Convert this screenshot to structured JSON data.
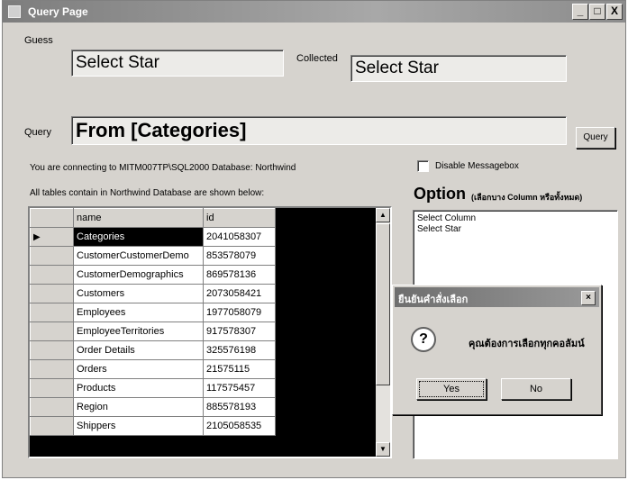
{
  "window": {
    "title": "Query Page",
    "minimize_glyph": "_",
    "maximize_glyph": "□",
    "close_glyph": "X"
  },
  "guess": {
    "label": "Guess",
    "value": "Select Star"
  },
  "collected": {
    "label": "Collected",
    "value": "Select Star"
  },
  "query": {
    "label": "Query",
    "value": "From [Categories]",
    "button_label": "Query"
  },
  "info": {
    "connection": "You are connecting to MITM007TP\\SQL2000    Database: Northwind",
    "tables_note": "All tables contain in Northwind Database are shown below:"
  },
  "disable_messagebox": {
    "label": "Disable Messagebox",
    "checked": false
  },
  "option": {
    "title": "Option",
    "subtitle": "(เลือกบาง Column หรือทั้งหมด)",
    "items": [
      "Select Column",
      "Select Star"
    ]
  },
  "grid": {
    "columns": [
      "name",
      "id"
    ],
    "rows": [
      {
        "name": "Categories",
        "id": "2041058307",
        "selected": true
      },
      {
        "name": "CustomerCustomerDemo",
        "id": "853578079",
        "selected": false
      },
      {
        "name": "CustomerDemographics",
        "id": "869578136",
        "selected": false
      },
      {
        "name": "Customers",
        "id": "2073058421",
        "selected": false
      },
      {
        "name": "Employees",
        "id": "1977058079",
        "selected": false
      },
      {
        "name": "EmployeeTerritories",
        "id": "917578307",
        "selected": false
      },
      {
        "name": "Order Details",
        "id": "325576198",
        "selected": false
      },
      {
        "name": "Orders",
        "id": "21575115",
        "selected": false
      },
      {
        "name": "Products",
        "id": "117575457",
        "selected": false
      },
      {
        "name": "Region",
        "id": "885578193",
        "selected": false
      },
      {
        "name": "Shippers",
        "id": "2105058535",
        "selected": false
      }
    ],
    "current_row_marker": "▶",
    "scroll_up": "▲",
    "scroll_down": "▼"
  },
  "dialog": {
    "title": "ยืนยันคำสั่งเลือก",
    "message": "คุณต้องการเลือกทุกคอลัมน์",
    "icon": "?",
    "close_glyph": "×",
    "yes_label": "Yes",
    "no_label": "No"
  }
}
